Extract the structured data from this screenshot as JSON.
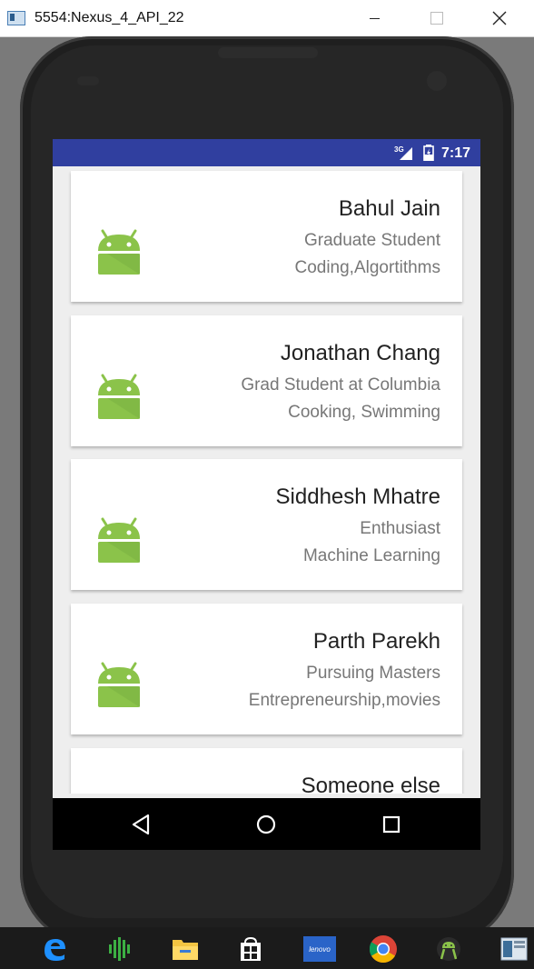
{
  "window": {
    "title": "5554:Nexus_4_API_22"
  },
  "status_bar": {
    "signal_label": "3G",
    "time": "7:17"
  },
  "cards": [
    {
      "name": "Bahul Jain",
      "line1": "Graduate Student",
      "line2": "Coding,Algortithms",
      "icon": "android-icon"
    },
    {
      "name": "Jonathan Chang",
      "line1": "Grad Student at Columbia",
      "line2": "Cooking, Swimming",
      "icon": "android-icon"
    },
    {
      "name": "Siddhesh Mhatre",
      "line1": "Enthusiast",
      "line2": "Machine Learning",
      "icon": "android-icon"
    },
    {
      "name": "Parth Parekh",
      "line1": "Pursuing Masters",
      "line2": "Entrepreneurship,movies",
      "icon": "android-icon"
    },
    {
      "name": "Someone else",
      "line1": "",
      "line2": "",
      "icon": "android-icon"
    }
  ],
  "nav_bar": {
    "buttons": [
      "back-icon",
      "home-icon",
      "recents-icon"
    ]
  },
  "taskbar": {
    "apps": [
      "edge-icon",
      "app-icon",
      "file-explorer-icon",
      "store-icon",
      "lenovo-icon",
      "chrome-icon",
      "android-studio-icon",
      "window-icon"
    ],
    "lenovo_label": "lenovo"
  },
  "colors": {
    "status_bar": "#303f9f",
    "android_green": "#8bc34a",
    "card_bg": "#ffffff",
    "screen_bg": "#eeeeee"
  }
}
